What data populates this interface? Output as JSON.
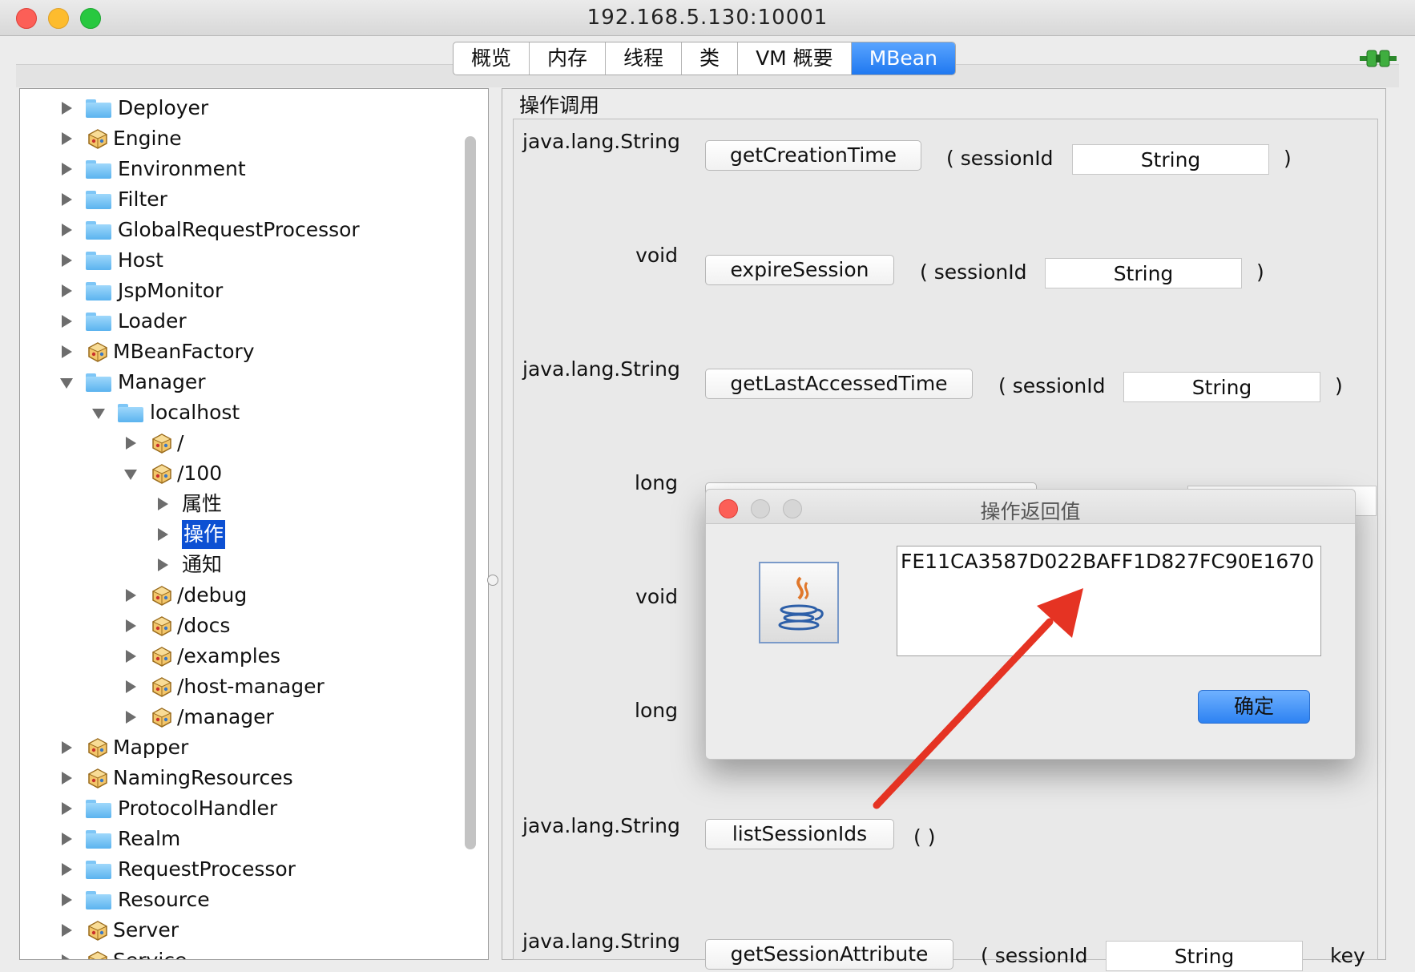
{
  "window": {
    "title": "192.168.5.130:10001"
  },
  "tabs": [
    {
      "label": "概览"
    },
    {
      "label": "内存"
    },
    {
      "label": "线程"
    },
    {
      "label": "类"
    },
    {
      "label": "VM 概要"
    },
    {
      "label": "MBean",
      "active": true
    }
  ],
  "tree": {
    "items": [
      {
        "label": "Deployer",
        "icon": "folder",
        "expanded": false
      },
      {
        "label": "Engine",
        "icon": "bean",
        "expanded": false
      },
      {
        "label": "Environment",
        "icon": "folder",
        "expanded": false
      },
      {
        "label": "Filter",
        "icon": "folder",
        "expanded": false
      },
      {
        "label": "GlobalRequestProcessor",
        "icon": "folder",
        "expanded": false
      },
      {
        "label": "Host",
        "icon": "folder",
        "expanded": false
      },
      {
        "label": "JspMonitor",
        "icon": "folder",
        "expanded": false
      },
      {
        "label": "Loader",
        "icon": "folder",
        "expanded": false
      },
      {
        "label": "MBeanFactory",
        "icon": "bean",
        "expanded": false
      },
      {
        "label": "Manager",
        "icon": "folder",
        "expanded": true
      },
      {
        "label": "localhost",
        "icon": "folder",
        "expanded": true
      },
      {
        "label": "/",
        "icon": "bean",
        "expanded": false
      },
      {
        "label": "/100",
        "icon": "bean",
        "expanded": true
      },
      {
        "label": "属性",
        "icon": "none",
        "expanded": false
      },
      {
        "label": "操作",
        "icon": "none",
        "expanded": false,
        "selected": true
      },
      {
        "label": "通知",
        "icon": "none",
        "expanded": false
      },
      {
        "label": "/debug",
        "icon": "bean",
        "expanded": false
      },
      {
        "label": "/docs",
        "icon": "bean",
        "expanded": false
      },
      {
        "label": "/examples",
        "icon": "bean",
        "expanded": false
      },
      {
        "label": "/host-manager",
        "icon": "bean",
        "expanded": false
      },
      {
        "label": "/manager",
        "icon": "bean",
        "expanded": false
      },
      {
        "label": "Mapper",
        "icon": "bean",
        "expanded": false
      },
      {
        "label": "NamingResources",
        "icon": "bean",
        "expanded": false
      },
      {
        "label": "ProtocolHandler",
        "icon": "folder",
        "expanded": false
      },
      {
        "label": "Realm",
        "icon": "folder",
        "expanded": false
      },
      {
        "label": "RequestProcessor",
        "icon": "folder",
        "expanded": false
      },
      {
        "label": "Resource",
        "icon": "folder",
        "expanded": false
      },
      {
        "label": "Server",
        "icon": "bean",
        "expanded": false
      },
      {
        "label": "Service",
        "icon": "bean",
        "expanded": false
      }
    ]
  },
  "operations": {
    "legend": "操作调用",
    "rows": [
      {
        "return_type": "java.lang.String",
        "name": "getCreationTime",
        "open": "( sessionId",
        "param": "String",
        "close": ")"
      },
      {
        "return_type": "void",
        "name": "expireSession",
        "open": "( sessionId",
        "param": "String",
        "close": ")"
      },
      {
        "return_type": "java.lang.String",
        "name": "getLastAccessedTime",
        "open": "( sessionId",
        "param": "String",
        "close": ")"
      },
      {
        "return_type": "long"
      },
      {
        "return_type": "void"
      },
      {
        "return_type": "long"
      },
      {
        "return_type": "java.lang.String",
        "name": "listSessionIds",
        "open": "( )"
      },
      {
        "return_type": "java.lang.String",
        "name": "getSessionAttribute",
        "open": "( sessionId",
        "param": "String",
        "close": "key"
      }
    ]
  },
  "dialog": {
    "title": "操作返回值",
    "result": "FE11CA3587D022BAFF1D827FC90E1670",
    "ok_label": "确定",
    "icon": "java-icon"
  },
  "colors": {
    "accent": "#1f78f0",
    "selection": "#0d50d3",
    "arrow": "#e53323"
  }
}
